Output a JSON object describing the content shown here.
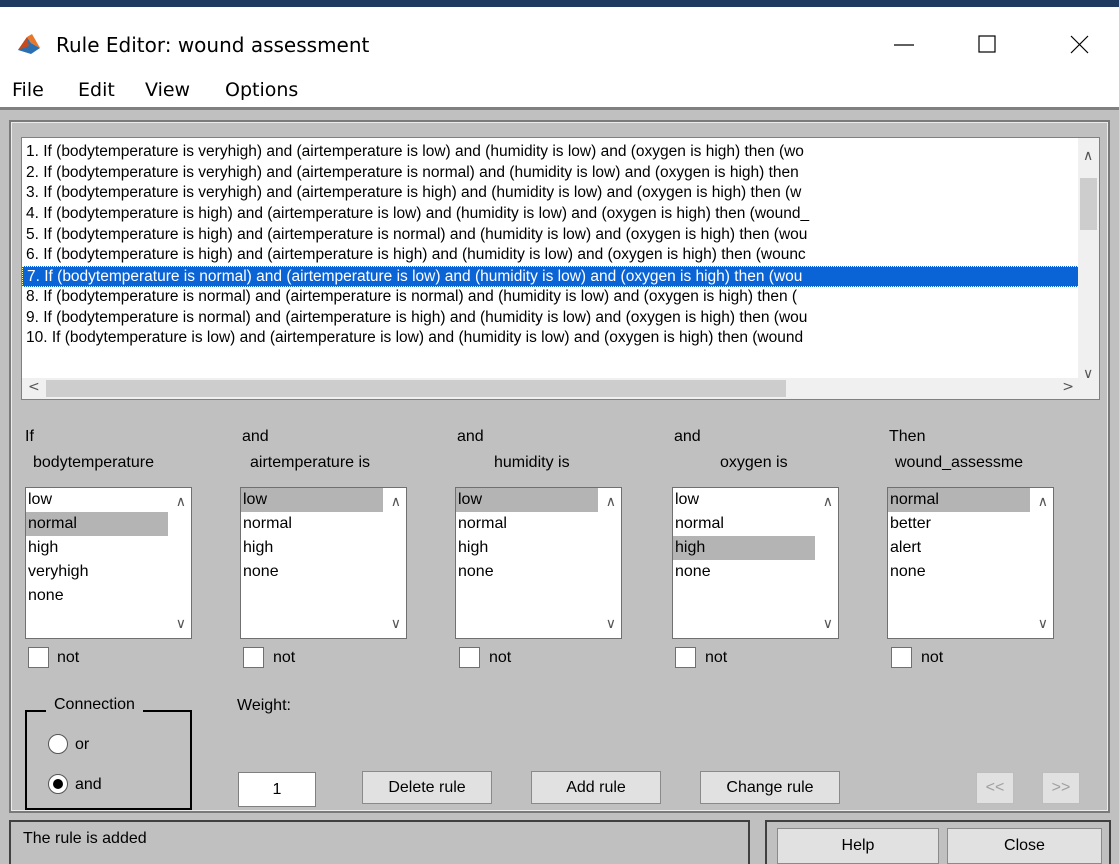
{
  "window": {
    "title": "Rule Editor: wound assessment",
    "icon": "matlab-icon"
  },
  "menu": [
    "File",
    "Edit",
    "View",
    "Options"
  ],
  "rules": [
    "1. If (bodytemperature is veryhigh) and (airtemperature is low) and (humidity is low) and (oxygen is high) then (wo",
    "2. If (bodytemperature is veryhigh) and (airtemperature is normal) and (humidity is low) and (oxygen is high) then",
    "3. If (bodytemperature is veryhigh) and (airtemperature is high) and (humidity is low) and (oxygen is high) then (w",
    "4. If (bodytemperature is high) and (airtemperature is low) and (humidity is low) and (oxygen is high) then (wound_",
    "5. If (bodytemperature is high) and (airtemperature is normal) and (humidity is low) and (oxygen is high) then (wou",
    "6. If (bodytemperature is high) and (airtemperature is high) and (humidity is low) and (oxygen is high) then (wounc",
    "7. If (bodytemperature is normal) and (airtemperature is low) and (humidity is low) and (oxygen is high) then (wou",
    "8. If (bodytemperature is normal) and (airtemperature is normal) and (humidity is low) and (oxygen is high) then (",
    "9. If (bodytemperature is normal) and (airtemperature is high) and (humidity is low) and (oxygen is high) then (wou",
    "10. If (bodytemperature is low) and (airtemperature is low) and (humidity is low) and (oxygen is high) then (wound"
  ],
  "selected_rule_index": 6,
  "columns": [
    {
      "head1": "If",
      "head2": "bodytemperature",
      "items": [
        "low",
        "normal",
        "high",
        "veryhigh",
        "none"
      ],
      "selected": "normal",
      "not_label": "not"
    },
    {
      "head1": "and",
      "head2": "airtemperature is",
      "items": [
        "low",
        "normal",
        "high",
        "none"
      ],
      "selected": "low",
      "not_label": "not"
    },
    {
      "head1": "and",
      "head2": "humidity is",
      "items": [
        "low",
        "normal",
        "high",
        "none"
      ],
      "selected": "low",
      "not_label": "not"
    },
    {
      "head1": "and",
      "head2": "oxygen is",
      "items": [
        "low",
        "normal",
        "high",
        "none"
      ],
      "selected": "high",
      "not_label": "not"
    },
    {
      "head1": "Then",
      "head2": "wound_assessme",
      "items": [
        "normal",
        "better",
        "alert",
        "none"
      ],
      "selected": "normal",
      "not_label": "not"
    }
  ],
  "connection": {
    "title": "Connection",
    "options": [
      "or",
      "and"
    ],
    "selected": "and"
  },
  "weight": {
    "label": "Weight:",
    "value": "1"
  },
  "buttons": {
    "delete": "Delete rule",
    "add": "Add rule",
    "change": "Change rule",
    "prev": "<<",
    "next": ">>",
    "help": "Help",
    "close": "Close"
  },
  "status": "The rule is added"
}
